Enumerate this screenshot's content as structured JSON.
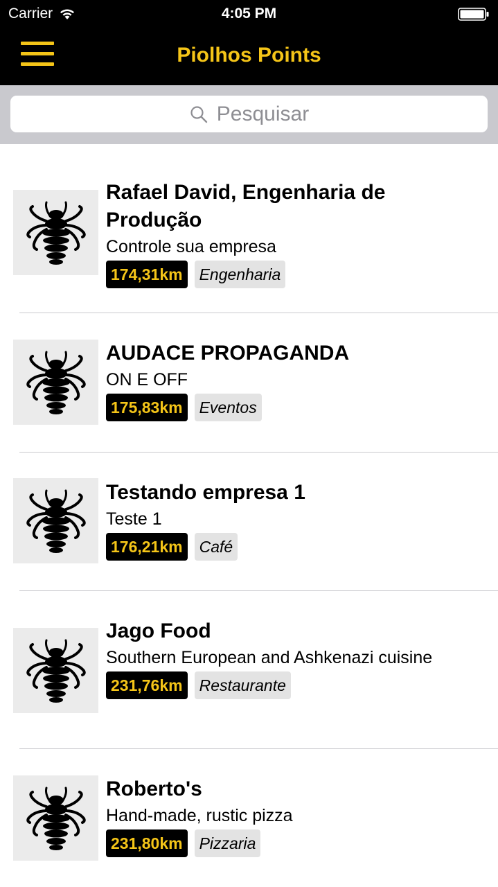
{
  "status_bar": {
    "carrier": "Carrier",
    "time": "4:05 PM",
    "wifi_icon": "wifi-icon",
    "battery_icon": "battery-full-icon"
  },
  "nav": {
    "title": "Piolhos Points",
    "menu_icon": "hamburger-menu-icon",
    "accent_color": "#f5c518",
    "background_color": "#000000"
  },
  "search": {
    "placeholder": "Pesquisar",
    "icon": "search-icon"
  },
  "items": [
    {
      "title": "Rafael David, Engenharia de Produção",
      "subtitle": "Controle sua empresa",
      "distance": "174,31km",
      "category": "Engenharia",
      "icon": "louse-icon"
    },
    {
      "title": "AUDACE PROPAGANDA",
      "subtitle": "ON E OFF",
      "distance": "175,83km",
      "category": "Eventos",
      "icon": "louse-icon"
    },
    {
      "title": "Testando empresa 1",
      "subtitle": "Teste 1",
      "distance": "176,21km",
      "category": "Café",
      "icon": "louse-icon"
    },
    {
      "title": "Jago Food",
      "subtitle": "Southern European and Ashkenazi cuisine",
      "distance": "231,76km",
      "category": "Restaurante",
      "icon": "louse-icon"
    },
    {
      "title": "Roberto's",
      "subtitle": "Hand-made, rustic pizza",
      "distance": "231,80km",
      "category": "Pizzaria",
      "icon": "louse-icon"
    }
  ]
}
